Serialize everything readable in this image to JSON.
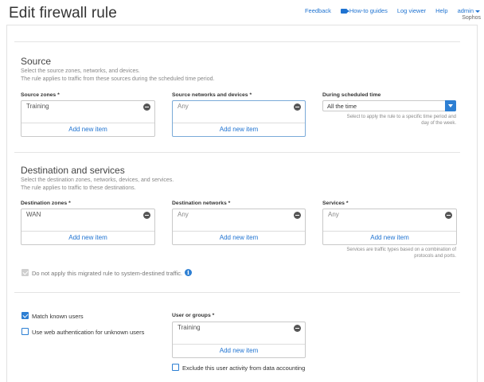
{
  "header": {
    "title": "Edit firewall rule",
    "links": {
      "feedback": "Feedback",
      "how_to": "How-to guides",
      "log_viewer": "Log viewer",
      "help": "Help",
      "admin": "admin"
    },
    "org": "Sophos"
  },
  "source": {
    "title": "Source",
    "desc_line1": "Select the source zones, networks, and devices.",
    "desc_line2": "The rule applies to traffic from these sources during the scheduled time period.",
    "zones": {
      "label": "Source zones",
      "value": "Training",
      "add": "Add new item"
    },
    "networks": {
      "label": "Source networks and devices",
      "value": "Any",
      "add": "Add new item"
    },
    "schedule": {
      "label": "During scheduled time",
      "value": "All the time",
      "hint_line1": "Select to apply the rule to a specific time period and",
      "hint_line2": "day of the week."
    }
  },
  "destination": {
    "title": "Destination and services",
    "desc_line1": "Select the destination zones, networks, devices, and services.",
    "desc_line2": "The rule applies to traffic to these destinations.",
    "zones": {
      "label": "Destination zones",
      "value": "WAN",
      "add": "Add new item"
    },
    "networks": {
      "label": "Destination networks",
      "value": "Any",
      "add": "Add new item"
    },
    "services": {
      "label": "Services",
      "value": "Any",
      "add": "Add new item",
      "hint_line1": "Services are traffic types based on a combination of",
      "hint_line2": "protocols and ports."
    },
    "migrated_option": {
      "label": "Do not apply this migrated rule to system-destined traffic.",
      "checked": true,
      "disabled": true
    }
  },
  "identity": {
    "match_known_users": {
      "label": "Match known users",
      "checked": true
    },
    "web_auth": {
      "label": "Use web authentication for unknown users",
      "checked": false
    },
    "user_groups": {
      "label": "User or groups",
      "value": "Training",
      "add": "Add new item"
    },
    "exclude": {
      "label": "Exclude this user activity from data accounting",
      "checked": false
    }
  },
  "required_marker": "*",
  "info_glyph": "i",
  "colors": {
    "accent": "#2d7fd3",
    "link": "#1f73d1"
  }
}
